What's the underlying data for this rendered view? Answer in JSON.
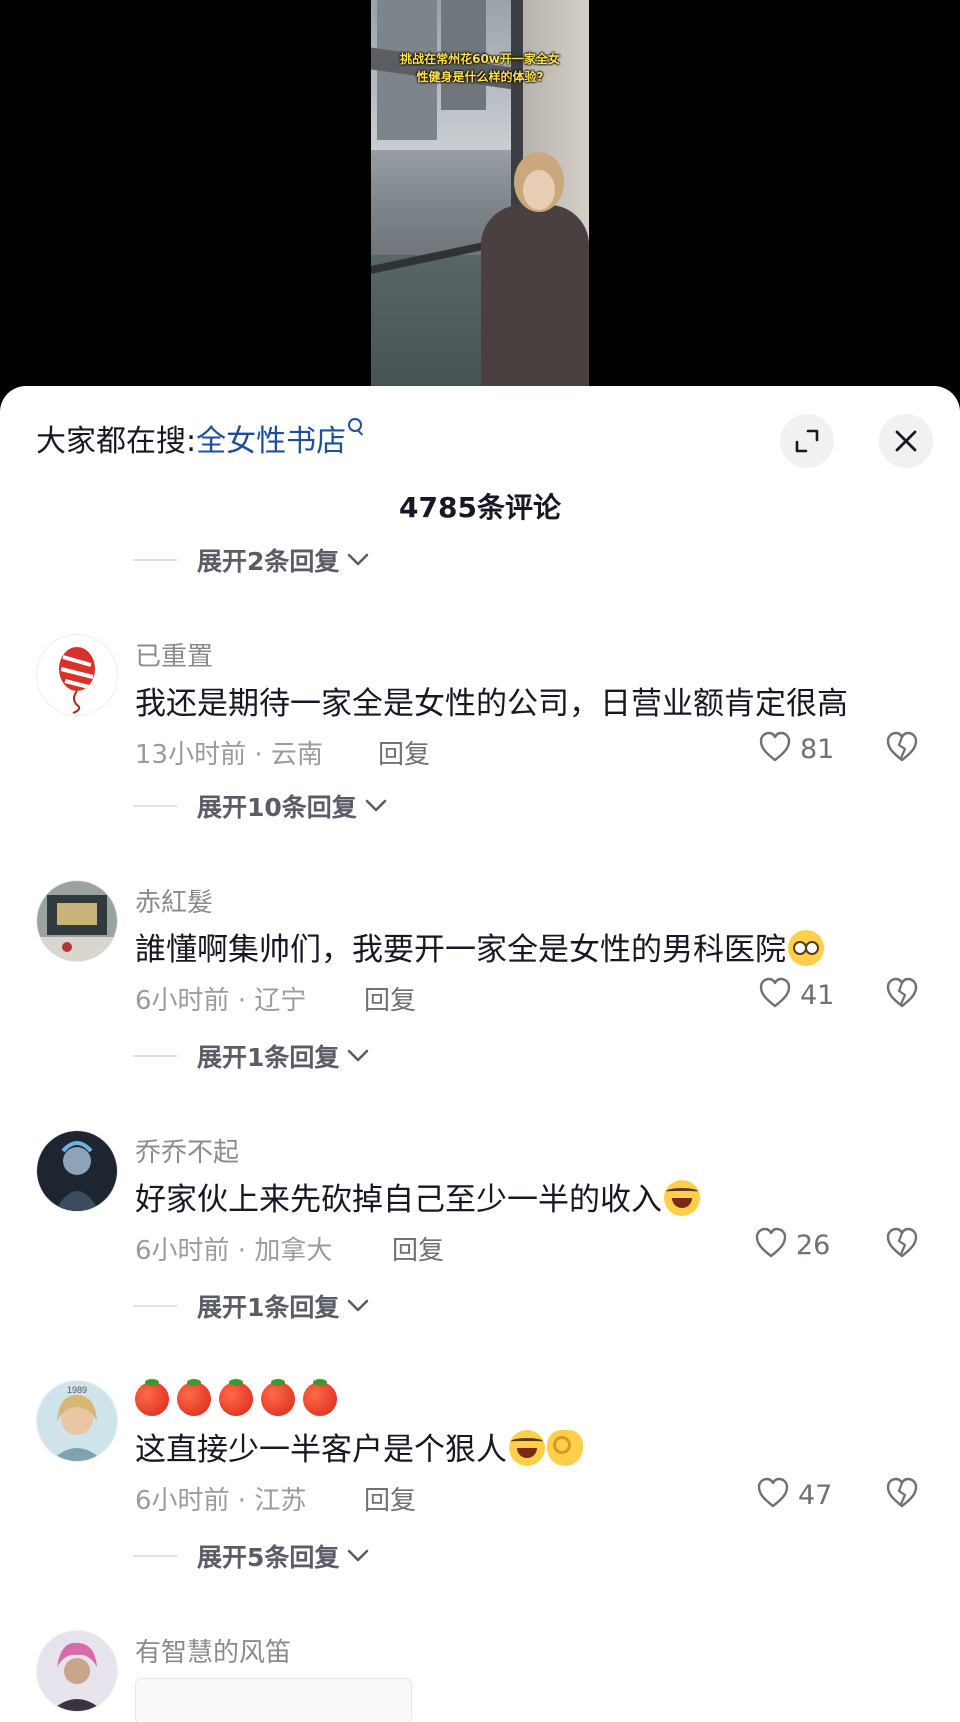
{
  "video": {
    "caption": "挑战在常州花60w开一家全女\n性健身是什么样的体验?"
  },
  "search": {
    "label": "大家都在搜:",
    "term": "全女性书店"
  },
  "comment_count": "4785条评论",
  "expand_top": "展开2条回复",
  "comments": [
    {
      "username": "已重置",
      "content": "我还是期待一家全是女性的公司，日营业额肯定很高",
      "time_location": "13小时前 · 云南",
      "reply": "回复",
      "likes": "81",
      "expand": "展开10条回复"
    },
    {
      "username": "赤紅髮",
      "content": "誰懂啊集帅们，我要开一家全是女性的男科医院",
      "time_location": "6小时前 · 辽宁",
      "reply": "回复",
      "likes": "41",
      "expand": "展开1条回复"
    },
    {
      "username": "乔乔不起",
      "content": "好家伙上来先砍掉自己至少一半的收入",
      "time_location": "6小时前 · 加拿大",
      "reply": "回复",
      "likes": "26",
      "expand": "展开1条回复"
    },
    {
      "username": "",
      "content": "这直接少一半客户是个狠人",
      "time_location": "6小时前 · 江苏",
      "reply": "回复",
      "likes": "47",
      "expand": "展开5条回复"
    },
    {
      "username": "有智慧的风笛"
    }
  ]
}
